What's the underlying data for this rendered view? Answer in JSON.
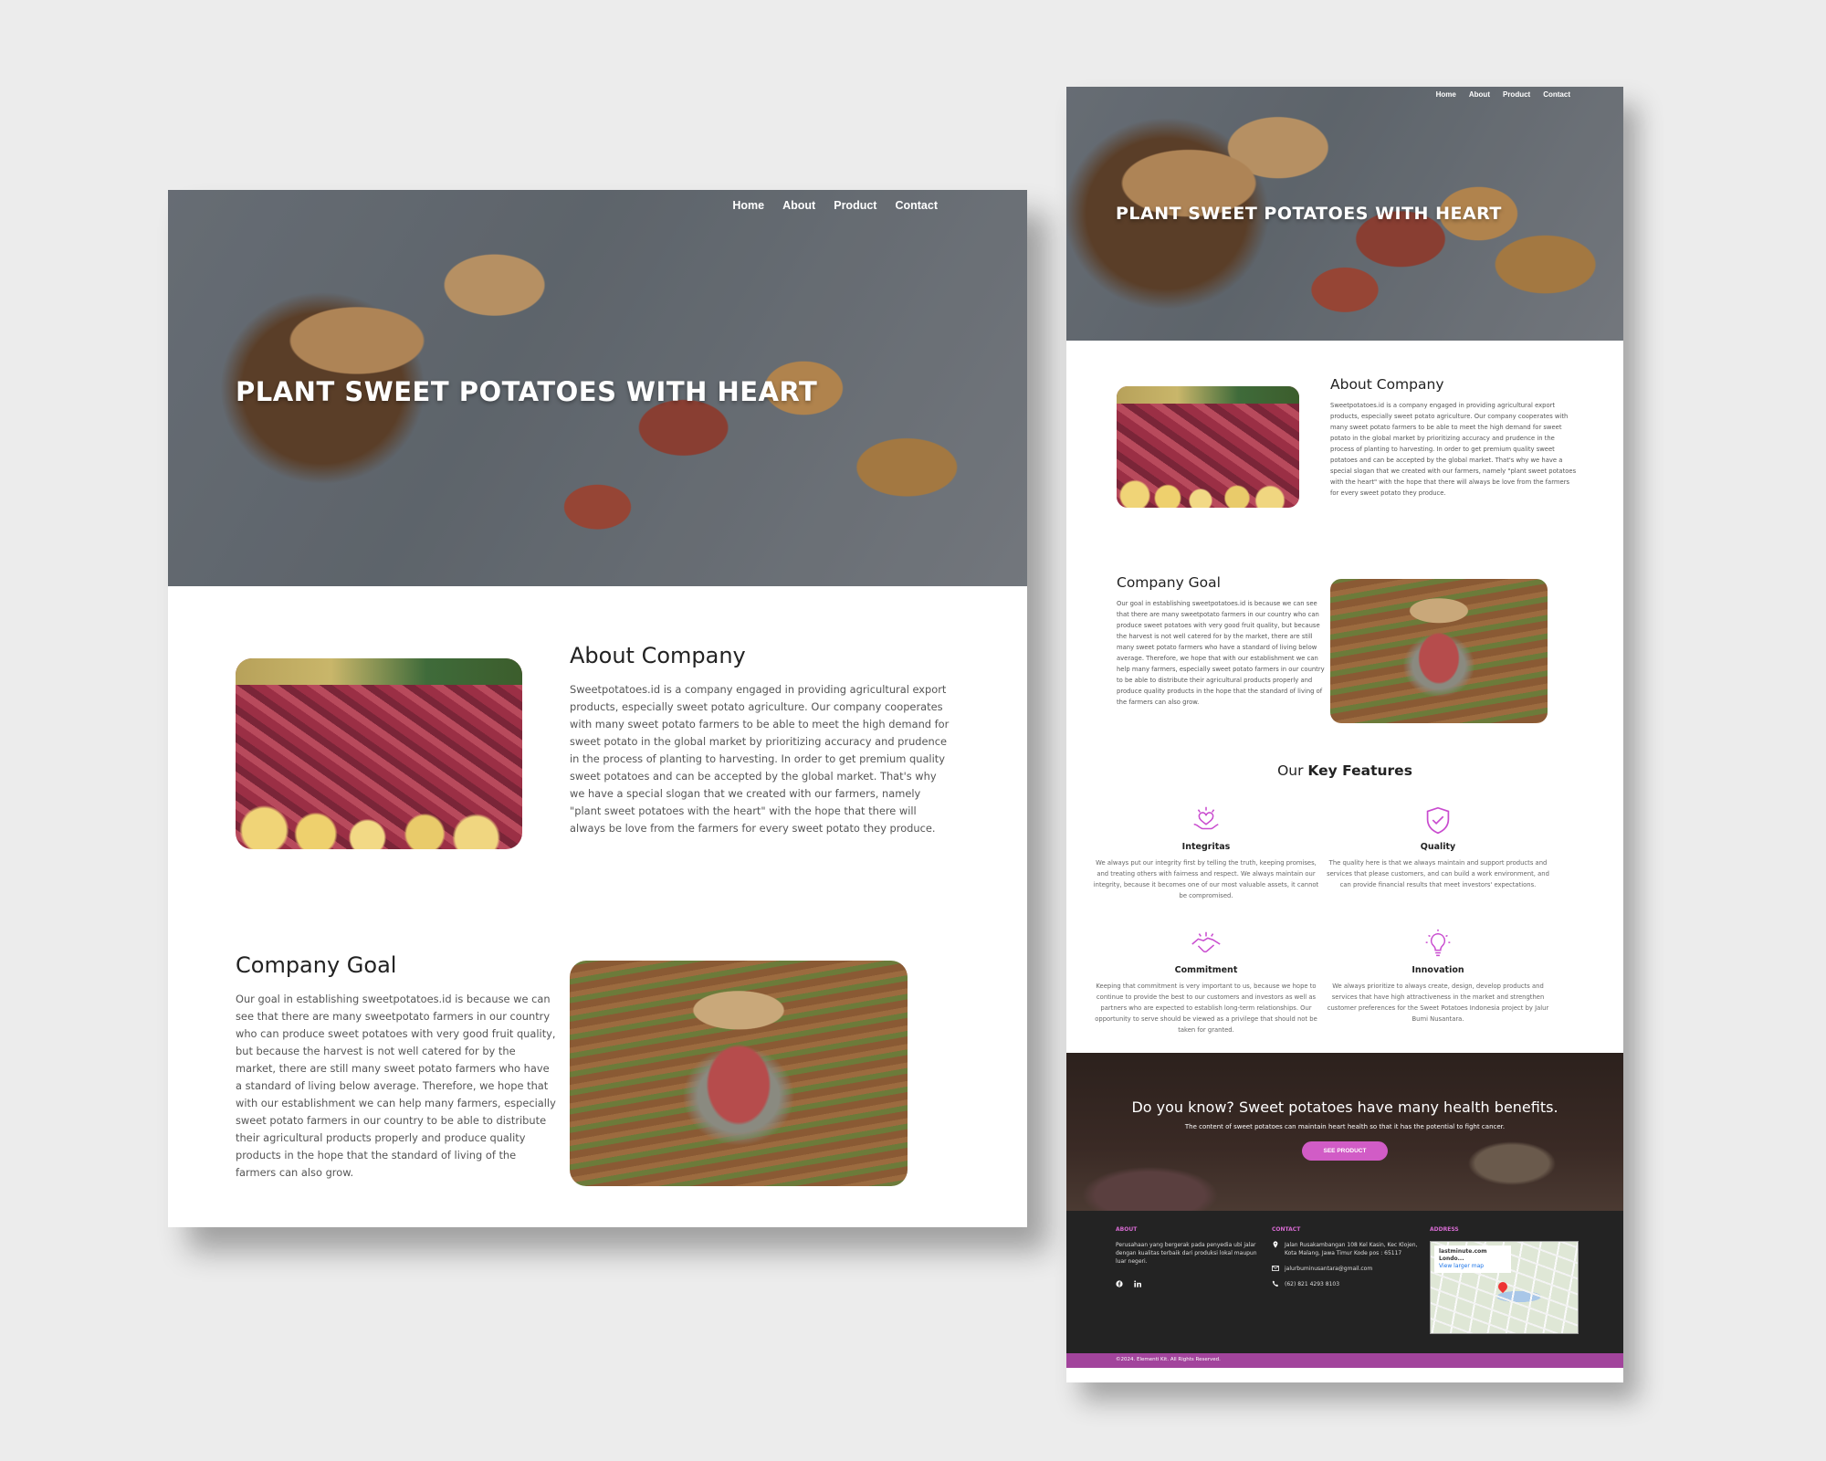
{
  "nav": [
    "Home",
    "About",
    "Product",
    "Contact"
  ],
  "hero_title": "PLANT SWEET POTATOES WITH HEART",
  "about": {
    "title": "About Company",
    "text": "Sweetpotatoes.id is a company engaged in providing agricultural export products, especially sweet potato agriculture. Our company cooperates with many sweet potato farmers to be able to meet the high demand for sweet potato in the global market by prioritizing accuracy and prudence in the process of planting to harvesting. In order to get premium quality sweet potatoes and can be accepted by the global market. That's why we have a special slogan that we created with our farmers, namely \"plant sweet potatoes with the heart\" with the hope that there will always be love from the farmers for every sweet potato they produce."
  },
  "goal": {
    "title": "Company Goal",
    "text": "Our goal in establishing sweetpotatoes.id is because we can see that there are many sweetpotato farmers in our country who can produce sweet potatoes with very good fruit quality, but because the harvest is not well catered for by the market, there are still many sweet potato farmers who have a standard of living below average. Therefore, we hope that with our establishment we can help many farmers, especially sweet potato farmers in our country to be able to distribute their agricultural products properly and produce quality products in the hope that the standard of living of the farmers can also grow."
  },
  "key_features": {
    "title_prefix": "Our",
    "title_bold": "Key Features",
    "items": [
      {
        "icon": "heart-hands-icon",
        "title": "Integritas",
        "text": "We always put our integrity first by telling the truth, keeping promises, and treating others with fairness and respect. We always maintain our integrity, because it becomes one of our most valuable assets, it cannot be compromised."
      },
      {
        "icon": "shield-check-icon",
        "title": "Quality",
        "text": "The quality here is that we always maintain and support products and services that please customers, and can build a work environment, and can provide financial results that meet investors' expectations."
      },
      {
        "icon": "handshake-icon",
        "title": "Commitment",
        "text": "Keeping that commitment is very important to us, because we hope to continue to provide the best to our customers and investors as well as partners who are expected to establish long-term relationships. Our opportunity to serve should be viewed as a privilege that should not be taken for granted."
      },
      {
        "icon": "lightbulb-icon",
        "title": "Innovation",
        "text": "We always prioritize to always create, design, develop products and services that have high attractiveness in the market and strengthen customer preferences for the Sweet Potatoes Indonesia project by Jalur Bumi Nusantara."
      }
    ]
  },
  "cta": {
    "title": "Do you know? Sweet potatoes have many health benefits.",
    "text": "The content of sweet potatoes can maintain heart health so that it has the potential to fight cancer.",
    "button": "SEE PRODUCT"
  },
  "footer": {
    "about_title": "ABOUT",
    "about_text": "Perusahaan yang bergerak pada penyedia ubi jalar dengan kualitas terbaik dari produksi lokal maupun luar negeri.",
    "contact_title": "CONTACT",
    "address_line": "Jalan Rusakambangan 108 Kel Kasin, Kec Klojen, Kota Malang, Jawa Timur Kode pos : 65117",
    "email": "jalurbuminusantara@gmail.com",
    "phone": "(62) 821 4293 8103",
    "address_title": "ADDRESS",
    "map_label": "lastminute.com Londo...",
    "map_link": "View larger map",
    "copyright": "©2024. Elementi Kit. All Rights Reserved."
  },
  "colors": {
    "accent": "#d15cc6",
    "footer_bar": "#a2449c",
    "footer_bg": "#232323"
  }
}
